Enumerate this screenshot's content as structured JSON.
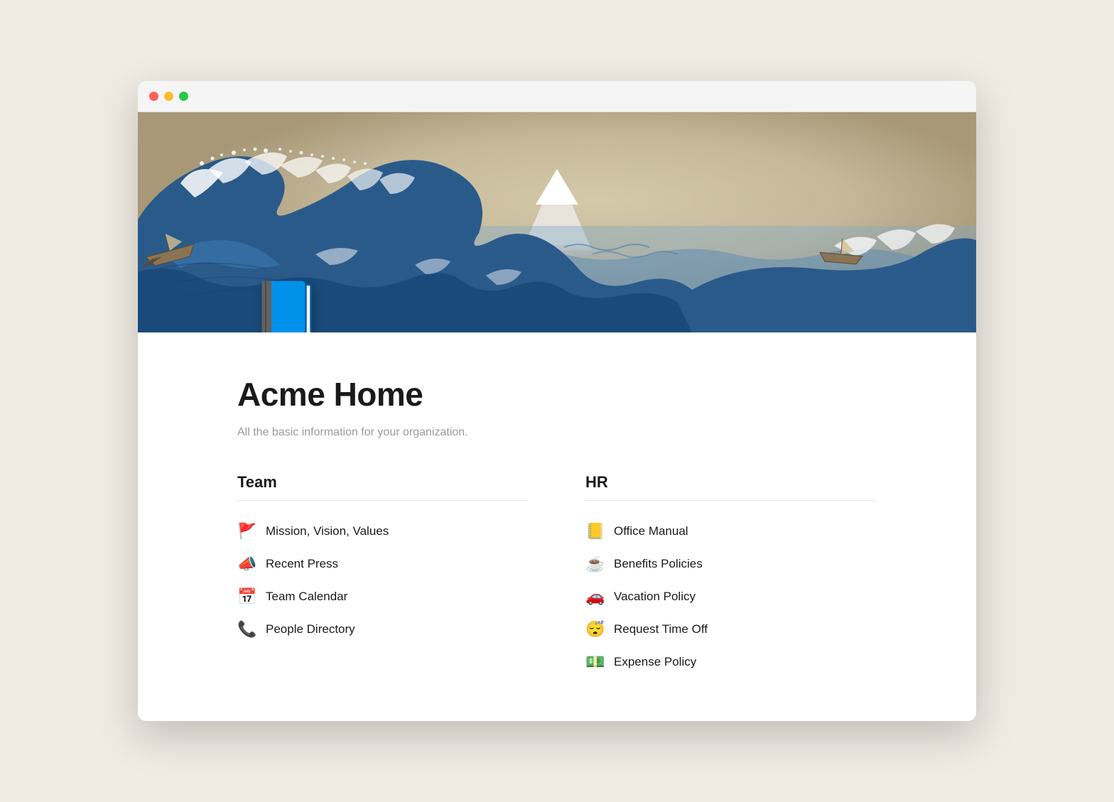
{
  "window": {
    "title": "Acme Home"
  },
  "traffic_lights": {
    "close": "close",
    "minimize": "minimize",
    "maximize": "maximize"
  },
  "page": {
    "title": "Acme Home",
    "subtitle": "All the basic information for your organization."
  },
  "sections": [
    {
      "id": "team",
      "heading": "Team",
      "items": [
        {
          "icon": "🚩",
          "label": "Mission, Vision, Values"
        },
        {
          "icon": "📣",
          "label": "Recent Press"
        },
        {
          "icon": "📅",
          "label": "Team Calendar"
        },
        {
          "icon": "📞",
          "label": "People Directory"
        }
      ]
    },
    {
      "id": "hr",
      "heading": "HR",
      "items": [
        {
          "icon": "📒",
          "label": "Office Manual"
        },
        {
          "icon": "☕",
          "label": "Benefits Policies"
        },
        {
          "icon": "🚗",
          "label": "Vacation Policy"
        },
        {
          "icon": "😴",
          "label": "Request Time Off"
        },
        {
          "icon": "💵",
          "label": "Expense Policy"
        }
      ]
    }
  ]
}
